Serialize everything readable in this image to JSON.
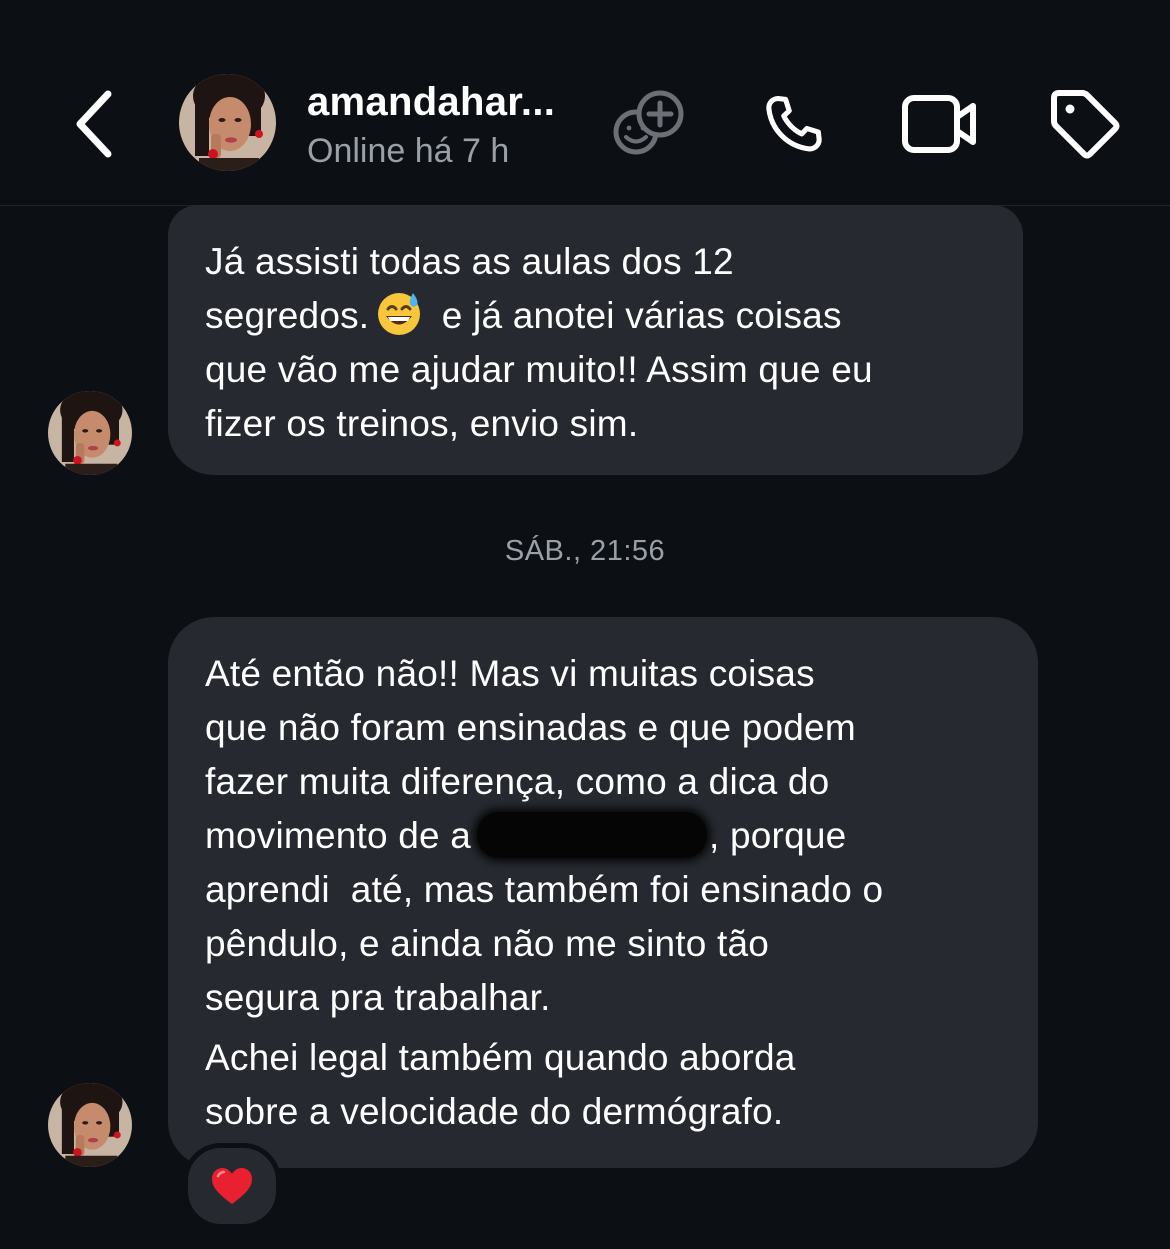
{
  "header": {
    "username": "amandahar...",
    "status": "Online há 7 h",
    "icons": {
      "back": "chevron-left-icon",
      "effects": "effects-add-icon",
      "call": "phone-icon",
      "video": "video-camera-icon",
      "tag": "tag-icon"
    }
  },
  "messages": [
    {
      "sender": "amandahar...",
      "lines": [
        "Já assisti todas as aulas dos 12",
        "segredos.",
        " e já anotei várias coisas",
        "que vão me ajudar muito!! Assim que eu",
        "fizer os treinos, envio sim."
      ],
      "emoji": "grinning-sweat-emoji"
    },
    {
      "timestamp": "SÁB., 21:56"
    },
    {
      "sender": "amandahar...",
      "lines": [
        "Até então não!! Mas vi muitas coisas",
        "que não foram ensinadas e que podem",
        "fazer muita diferença, como a dica do",
        "movimento de a",
        ", porque",
        "aprendi  até, mas também foi ensinado o",
        "pêndulo, e ainda não me sinto tão",
        "segura pra trabalhar.",
        "Achei legal também quando aborda",
        "sobre a velocidade do dermógrafo."
      ],
      "reaction": "❤️"
    }
  ],
  "colors": {
    "background": "#0c0f14",
    "bubble": "#262a30",
    "secondary_text": "#9aa0a8",
    "heart": "#e8202f"
  }
}
